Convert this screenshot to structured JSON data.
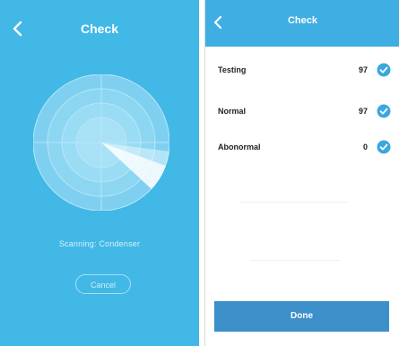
{
  "left_screen": {
    "title": "Check",
    "scanning_text": "Scanning: Condenser",
    "cancel_label": "Cancel"
  },
  "right_screen": {
    "title": "Check",
    "results": [
      {
        "label": "Testing",
        "value": "97"
      },
      {
        "label": "Normal",
        "value": "97"
      },
      {
        "label": "Abonormal",
        "value": "0"
      }
    ],
    "done_label": "Done"
  },
  "colors": {
    "left_background": "#41b8e6",
    "header_blue": "#3faee3",
    "done_button": "#3c8fc9",
    "check_icon": "#3aa7df"
  },
  "icons": {
    "back": "chevron-left-icon",
    "status": "check-circle-icon"
  }
}
